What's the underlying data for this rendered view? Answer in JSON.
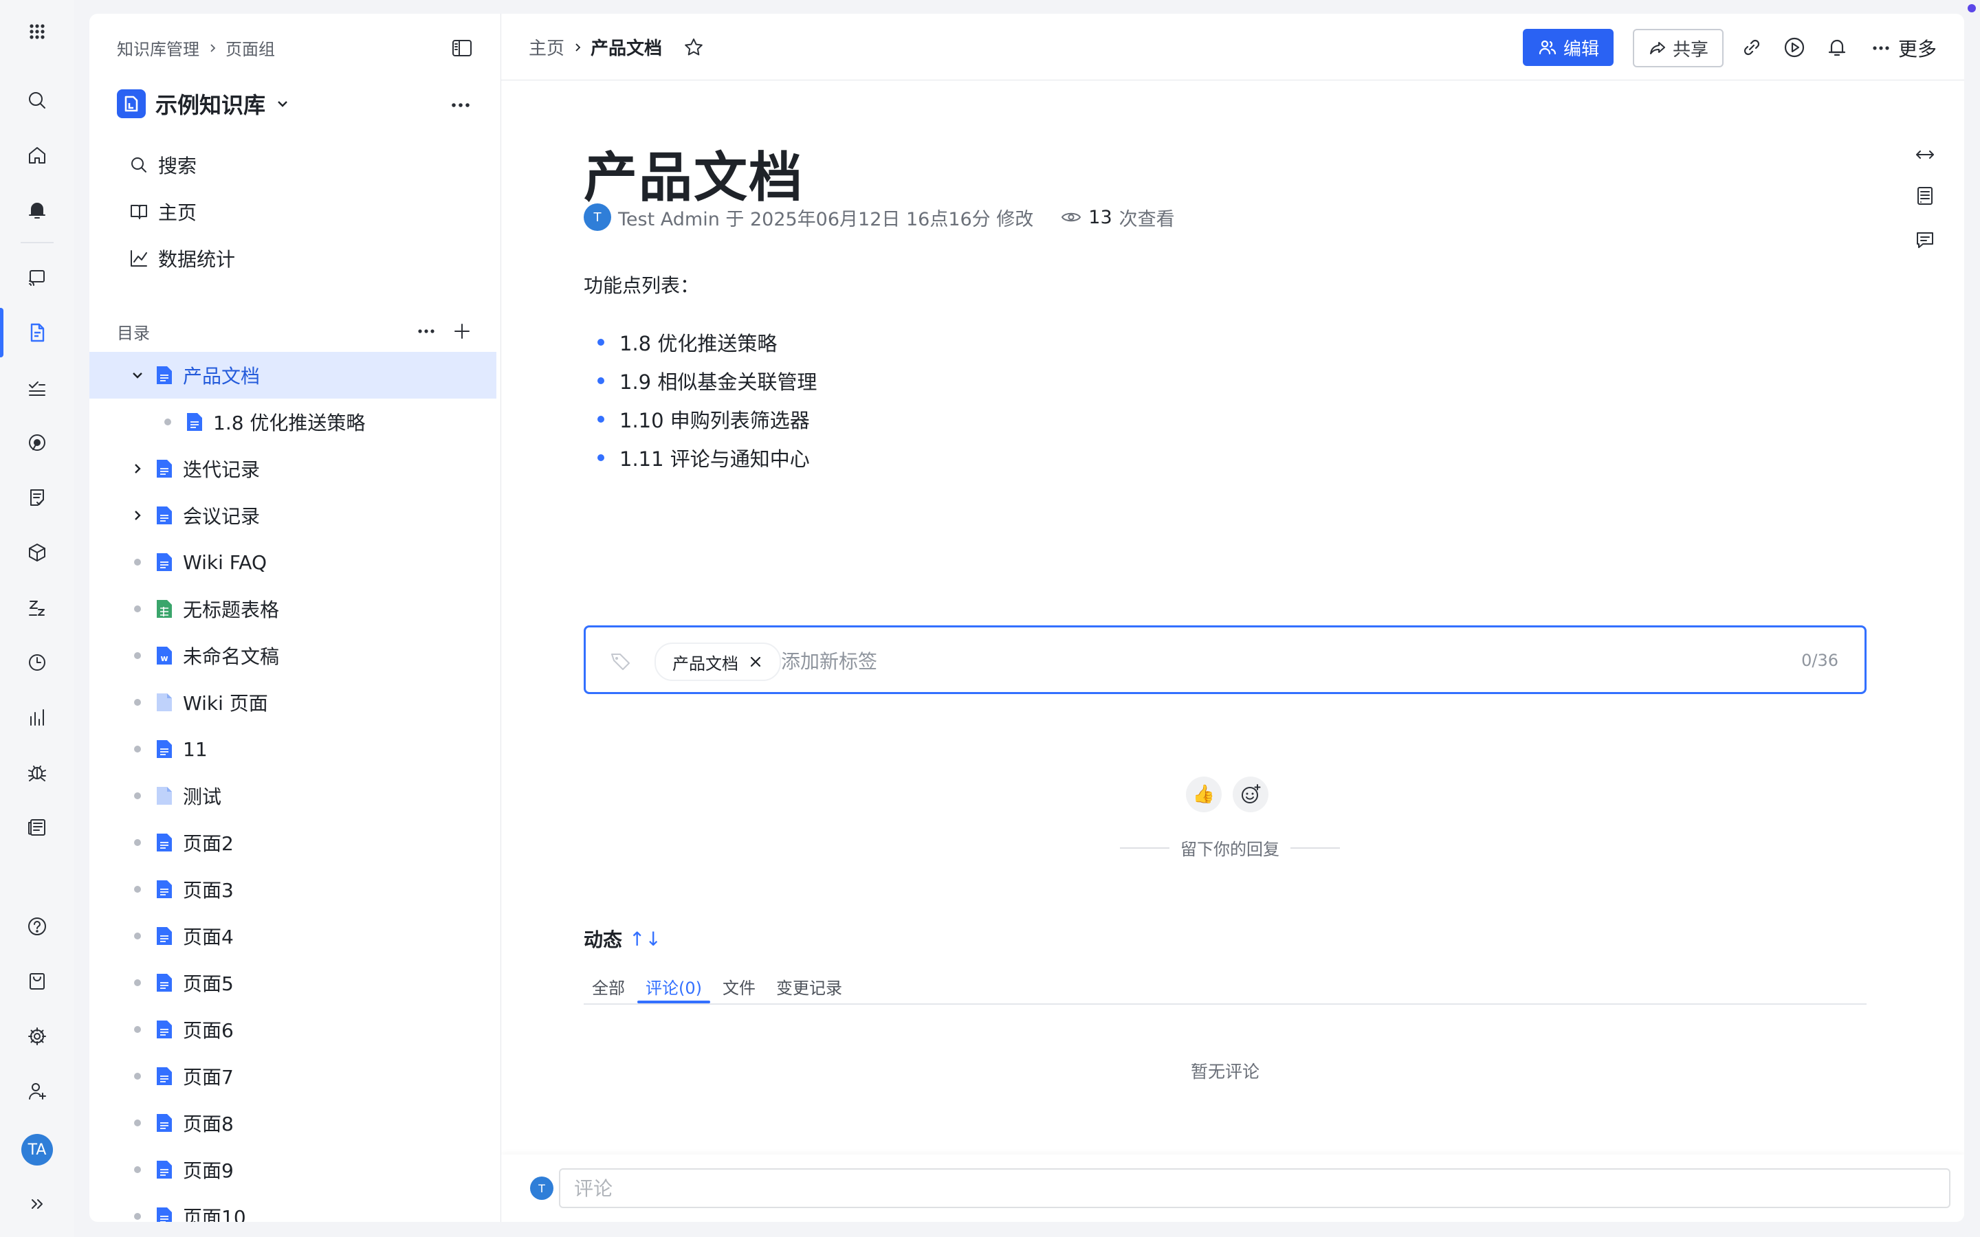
{
  "rail": {
    "items": [
      "apps",
      "search",
      "home",
      "notifications",
      "cast",
      "docs",
      "tasks",
      "target",
      "forms",
      "packages",
      "zzz",
      "history",
      "analytics",
      "bugs",
      "news",
      "help",
      "inbox",
      "settings",
      "add-user"
    ],
    "active": "docs",
    "avatar": "TA"
  },
  "nav": {
    "breadcrumb": [
      "知识库管理",
      "页面组"
    ],
    "kb_title": "示例知识库",
    "menu": [
      {
        "label": "搜索",
        "icon": "search-icon"
      },
      {
        "label": "主页",
        "icon": "book-icon"
      },
      {
        "label": "数据统计",
        "icon": "chart-line-icon"
      }
    ],
    "toc_label": "目录",
    "toc": [
      {
        "label": "产品文档",
        "type": "doc",
        "ctrl": "expanded",
        "level": 0,
        "active": true
      },
      {
        "label": "1.8 优化推送策略",
        "type": "doc",
        "ctrl": "dot",
        "level": 1
      },
      {
        "label": "迭代记录",
        "type": "doc",
        "ctrl": "collapsed",
        "level": 0
      },
      {
        "label": "会议记录",
        "type": "doc",
        "ctrl": "collapsed",
        "level": 0
      },
      {
        "label": "Wiki FAQ",
        "type": "doc",
        "ctrl": "dot",
        "level": 0
      },
      {
        "label": "无标题表格",
        "type": "sheet",
        "ctrl": "dot",
        "level": 0
      },
      {
        "label": "未命名文稿",
        "type": "word",
        "ctrl": "dot",
        "level": 0
      },
      {
        "label": "Wiki 页面",
        "type": "page",
        "ctrl": "dot",
        "level": 0
      },
      {
        "label": "11",
        "type": "doc",
        "ctrl": "dot",
        "level": 0
      },
      {
        "label": "测试",
        "type": "page",
        "ctrl": "dot",
        "level": 0
      },
      {
        "label": "页面2",
        "type": "doc",
        "ctrl": "dot",
        "level": 0
      },
      {
        "label": "页面3",
        "type": "doc",
        "ctrl": "dot",
        "level": 0
      },
      {
        "label": "页面4",
        "type": "doc",
        "ctrl": "dot",
        "level": 0
      },
      {
        "label": "页面5",
        "type": "doc",
        "ctrl": "dot",
        "level": 0
      },
      {
        "label": "页面6",
        "type": "doc",
        "ctrl": "dot",
        "level": 0
      },
      {
        "label": "页面7",
        "type": "doc",
        "ctrl": "dot",
        "level": 0
      },
      {
        "label": "页面8",
        "type": "doc",
        "ctrl": "dot",
        "level": 0
      },
      {
        "label": "页面9",
        "type": "doc",
        "ctrl": "dot",
        "level": 0
      },
      {
        "label": "页面10",
        "type": "doc",
        "ctrl": "dot",
        "level": 0
      }
    ]
  },
  "header": {
    "breadcrumb_home": "主页",
    "breadcrumb_current": "产品文档",
    "edit_label": "编辑",
    "share_label": "共享",
    "more_label": "更多"
  },
  "doc": {
    "title": "产品文档",
    "author_initial": "T",
    "meta": "Test Admin 于 2025年06月12日 16点16分 修改",
    "views_count": "13",
    "views_suffix": "次查看",
    "body_label": "功能点列表：",
    "features": [
      "1.8 优化推送策略",
      "1.9 相似基金关联管理",
      "1.10 申购列表筛选器",
      "1.11 评论与通知中心"
    ]
  },
  "tags": {
    "chip": "产品文档",
    "placeholder": "添加新标签",
    "counter": "0/36"
  },
  "reactions": {
    "like_emoji": "👍",
    "reply_hint": "留下你的回复"
  },
  "activity": {
    "title": "动态",
    "sort_glyph": "↑↓",
    "tabs": [
      "全部",
      "评论(0)",
      "文件",
      "变更记录"
    ],
    "active_tab": 1,
    "empty": "暂无评论"
  },
  "comment": {
    "avatar": "T",
    "placeholder": "评论"
  },
  "colors": {
    "accent": "#3370ff",
    "edit_button": "#2a62f3",
    "active_row_bg": "#e1eaff"
  }
}
